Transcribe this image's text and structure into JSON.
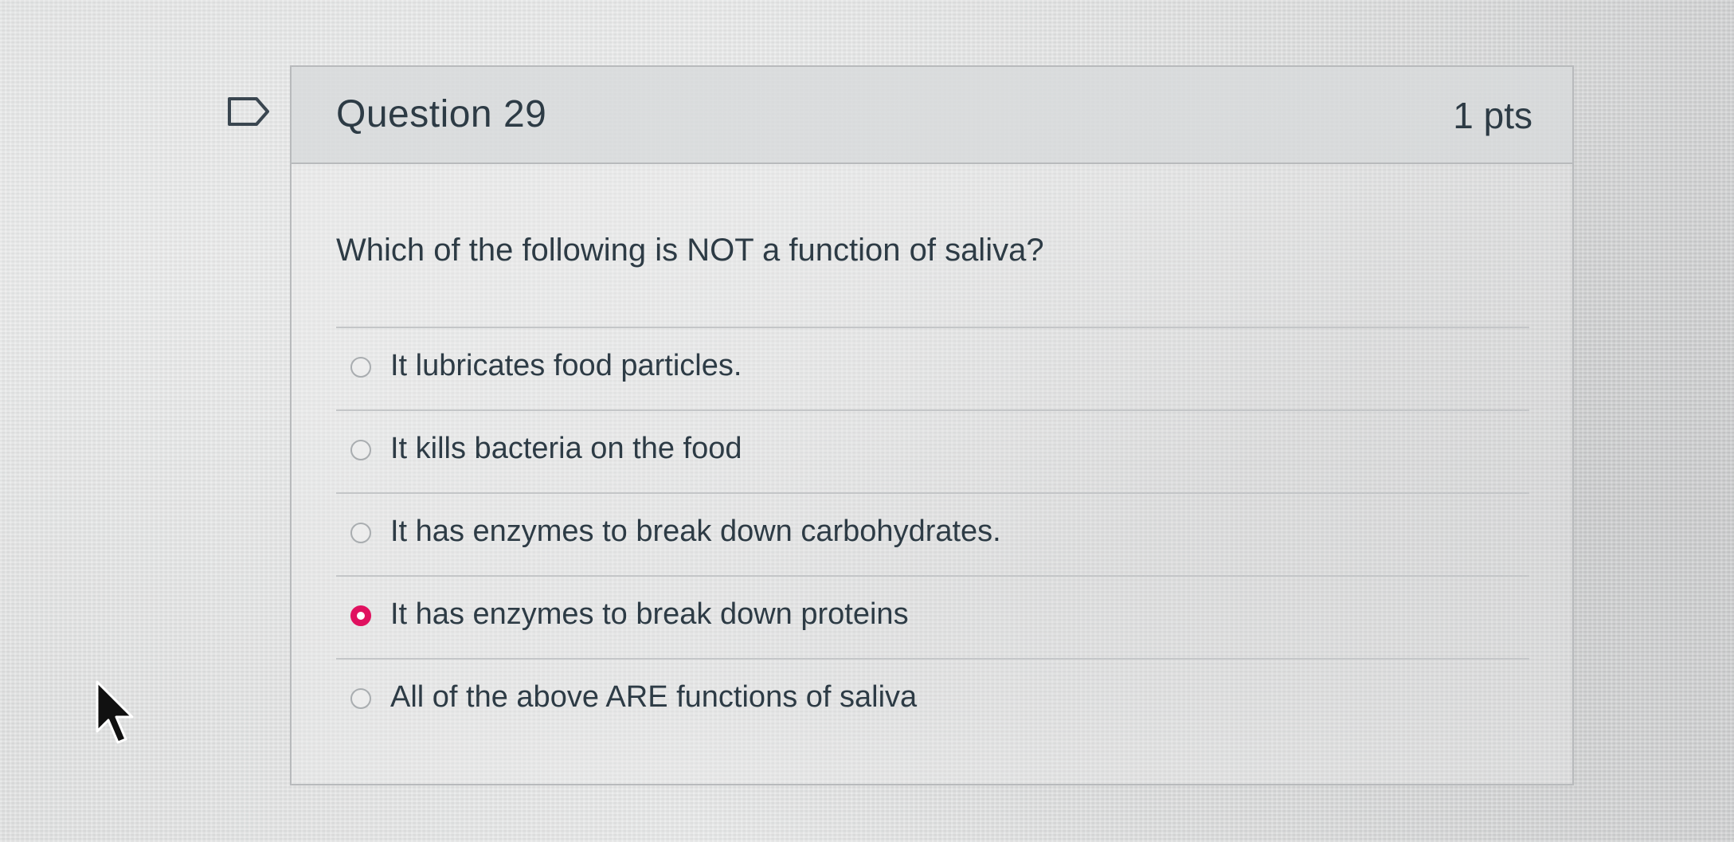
{
  "question": {
    "title": "Question 29",
    "points": "1 pts",
    "text": "Which of the following is NOT a function of saliva?",
    "answers": [
      {
        "label": "It lubricates food particles.",
        "selected": false
      },
      {
        "label": "It kills bacteria on the food",
        "selected": false
      },
      {
        "label": "It has enzymes to break down carbohydrates.",
        "selected": false
      },
      {
        "label": "It has enzymes to break down proteins",
        "selected": true
      },
      {
        "label": "All of the above ARE functions of saliva",
        "selected": false
      }
    ]
  },
  "colors": {
    "accent_selected": "#e0115f",
    "text": "#2d3b45",
    "border": "#b8babc"
  },
  "icons": {
    "flag": "bookmark-flag-icon",
    "pointer": "mouse-pointer-icon"
  }
}
